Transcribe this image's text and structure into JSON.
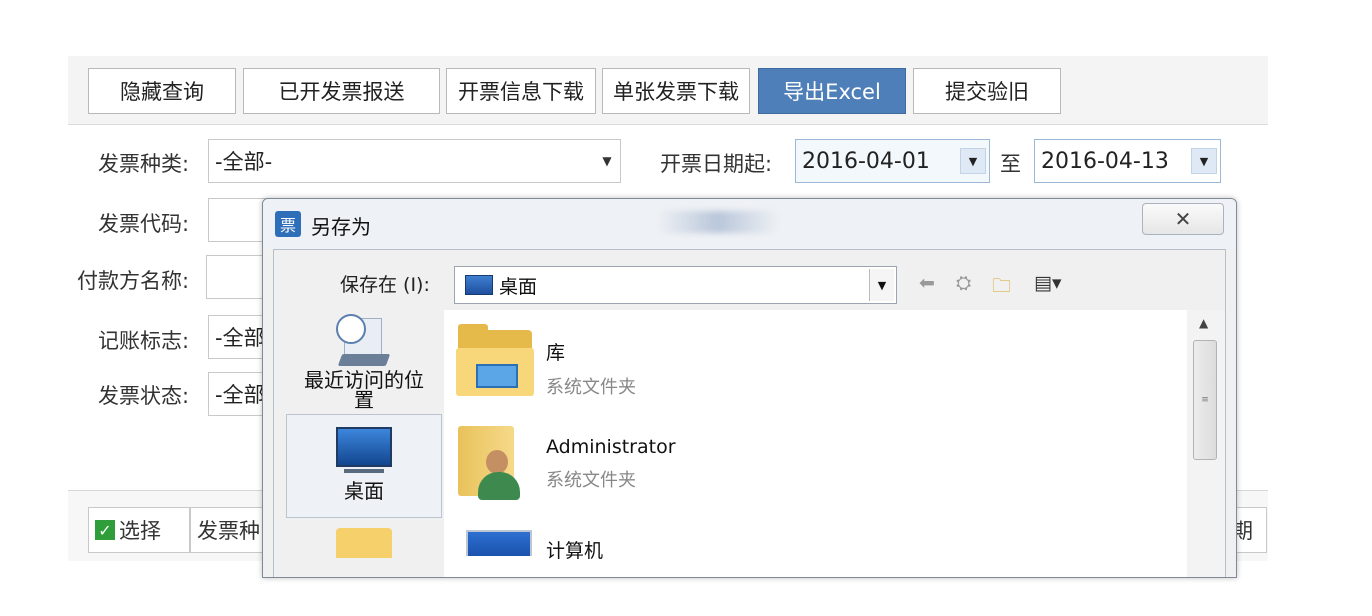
{
  "toolbar": {
    "buttons": [
      {
        "label": "隐藏查询"
      },
      {
        "label": "已开发票报送"
      },
      {
        "label": "开票信息下载"
      },
      {
        "label": "单张发票下载"
      },
      {
        "label": "导出Excel",
        "active": true
      },
      {
        "label": "提交验旧"
      }
    ]
  },
  "filters": {
    "invoice_type_label": "发票种类:",
    "invoice_type_value": "-全部-",
    "date_from_label": "开票日期起:",
    "date_from": "2016-04-01",
    "date_to_label": "至",
    "date_to": "2016-04-13",
    "invoice_code_label": "发票代码:",
    "payer_name_label": "付款方名称:",
    "posting_flag_label": "记账标志:",
    "posting_flag_value": "-全部",
    "invoice_status_label": "发票状态:",
    "invoice_status_value": "-全部"
  },
  "grid": {
    "select_label": "选择",
    "col2_label": "发票种",
    "col_right_label": "期"
  },
  "dialog": {
    "title": "另存为",
    "close_symbol": "✕",
    "save_in_label": "保存在 (I):",
    "save_in_value": "桌面",
    "places": [
      {
        "label": "最近访问的位置"
      },
      {
        "label": "桌面"
      }
    ],
    "files": [
      {
        "name": "库",
        "type": "系统文件夹"
      },
      {
        "name": "Administrator",
        "type": "系统文件夹"
      },
      {
        "name": "计算机",
        "type": ""
      }
    ]
  },
  "colors": {
    "accent_button": "#4f7fb8",
    "select_check": "#2f9e3a"
  }
}
